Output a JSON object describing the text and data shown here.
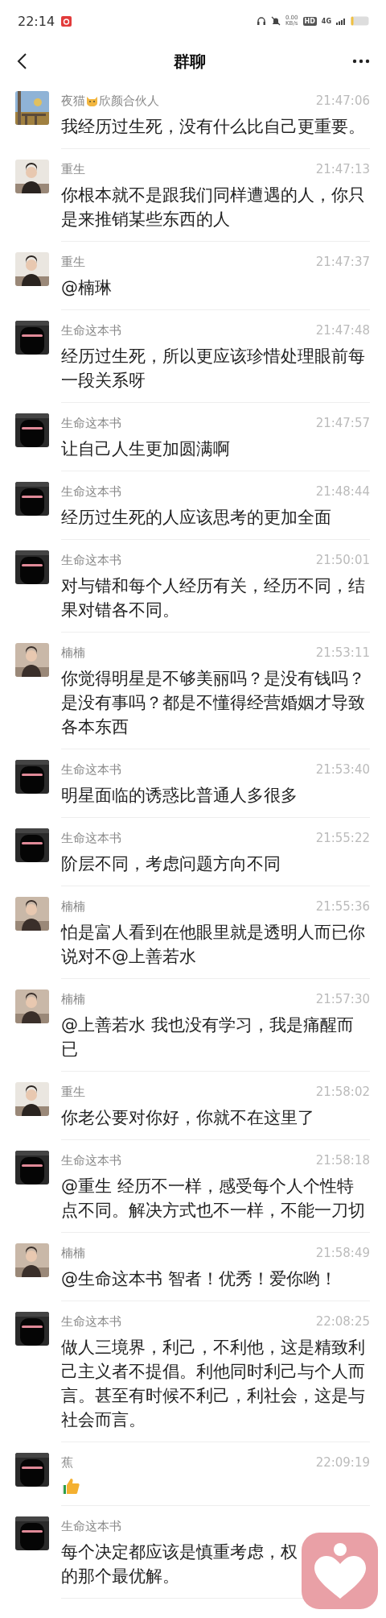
{
  "status_bar": {
    "time": "22:14",
    "net_speed": "0.00",
    "net_unit": "KB/s",
    "hd": "HD",
    "network": "4G"
  },
  "header": {
    "title": "群聊"
  },
  "messages": [
    {
      "kind": "text",
      "sender": "夜猫",
      "sender_parts": [
        {
          "kind": "cat_emoji"
        },
        {
          "kind": "text",
          "text": "欣颜合伙人"
        }
      ],
      "time": "21:47:06",
      "text": "我经历过生死，没有什么比自己更重要。"
    },
    {
      "kind": "text",
      "sender": "重生",
      "time": "21:47:13",
      "text": "你根本就不是跟我们同样遭遇的人，你只是来推销某些东西的人"
    },
    {
      "kind": "text",
      "sender": "重生",
      "time": "21:47:37",
      "text": "@楠琳"
    },
    {
      "kind": "text",
      "sender": "生命这本书",
      "time": "21:47:48",
      "text": "经历过生死，所以更应该珍惜处理眼前每一段关系呀"
    },
    {
      "kind": "text",
      "sender": "生命这本书",
      "time": "21:47:57",
      "text": "让自己人生更加圆满啊"
    },
    {
      "kind": "text",
      "sender": "生命这本书",
      "time": "21:48:44",
      "text": "经历过生死的人应该思考的更加全面"
    },
    {
      "kind": "text",
      "sender": "生命这本书",
      "time": "21:50:01",
      "text": "对与错和每个人经历有关，经历不同，结果对错各不同。"
    },
    {
      "kind": "text",
      "sender": "楠楠",
      "time": "21:53:11",
      "text": "你觉得明星是不够美丽吗？是没有钱吗？是没有事吗？都是不懂得经营婚姻才导致各本东西"
    },
    {
      "kind": "text",
      "sender": "生命这本书",
      "time": "21:53:40",
      "text": "明星面临的诱惑比普通人多很多"
    },
    {
      "kind": "text",
      "sender": "生命这本书",
      "time": "21:55:22",
      "text": "阶层不同，考虑问题方向不同"
    },
    {
      "kind": "text",
      "sender": "楠楠",
      "time": "21:55:36",
      "text": "怕是富人看到在他眼里就是透明人而已你说对不@上善若水"
    },
    {
      "kind": "text",
      "sender": "楠楠",
      "time": "21:57:30",
      "text": "@上善若水 我也没有学习，我是痛醒而已"
    },
    {
      "kind": "text",
      "sender": "重生",
      "time": "21:58:02",
      "text": "你老公要对你好，你就不在这里了"
    },
    {
      "kind": "text",
      "sender": "生命这本书",
      "time": "21:58:18",
      "text": "@重生 经历不一样，感受每个人个性特点不同。解决方式也不一样，不能一刀切"
    },
    {
      "kind": "text",
      "sender": "楠楠",
      "time": "21:58:49",
      "text": "@生命这本书 智者！优秀！爱你哟！"
    },
    {
      "kind": "text",
      "sender": "生命这本书",
      "time": "22:08:25",
      "text": "做人三境界，利己，不利他，这是精致利己主义者不提倡。利他同时利己与个人而言。甚至有时候不利己，利社会，这是与社会而言。"
    },
    {
      "kind": "thumbs_up",
      "sender": "蕉",
      "time": "22:09:19"
    },
    {
      "kind": "text",
      "sender": "生命这本书",
      "text": "每个决定都应该是慎重考虑，权",
      "text_after": "的那个最优解。"
    }
  ],
  "floating_button": {
    "kind": "heart"
  }
}
